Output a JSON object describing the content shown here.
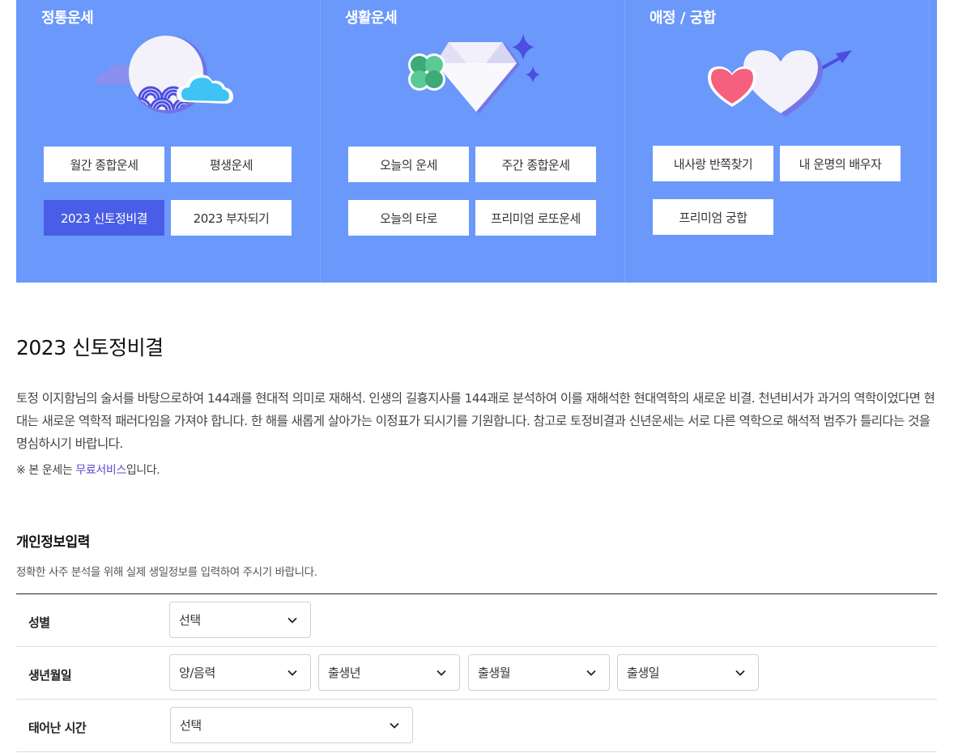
{
  "menu": {
    "columns": [
      {
        "title": "정통운세",
        "buttons": [
          "월간 종합운세",
          "평생운세",
          "2023 신토정비결",
          "2023 부자되기"
        ],
        "active_index": 2
      },
      {
        "title": "생활운세",
        "buttons": [
          "오늘의 운세",
          "주간 종합운세",
          "오늘의 타로",
          "프리미엄 로또운세"
        ],
        "active_index": -1
      },
      {
        "title": "애정 / 궁합",
        "buttons": [
          "내사랑 반쪽찾기",
          "내 운명의 배우자",
          "프리미엄 궁합"
        ],
        "active_index": -1
      }
    ]
  },
  "page": {
    "title": "2023 신토정비결",
    "description": "토정 이지함님의 술서를 바탕으로하여 144괘를 현대적 의미로 재해석. 인생의 길흉지사를 144괘로 분석하여 이를 재해석한 현대역학의 새로운 비결. 천년비서가 과거의 역학이었다면 현대는 새로운 역학적 패러다임을 가져야 합니다. 한 해를 새롭게 살아가는 이정표가 되시기를 기원합니다. 참고로 토정비결과 신년운세는 서로 다른 역학으로 해석적 범주가 틀리다는 것을 명심하시기 바랍니다.",
    "note_prefix": "※ 본 운세는 ",
    "note_highlight": "무료서비스",
    "note_suffix": "입니다."
  },
  "form": {
    "title": "개인정보입력",
    "subtitle": "정확한 사주 분석을 위해 실제 생일정보를 입력하여 주시기 바랍니다.",
    "gender": {
      "label": "성별",
      "value": "선택"
    },
    "birth": {
      "label": "생년월일",
      "calendar": "양/음력",
      "year": "출생년",
      "month": "출생월",
      "day": "출생일"
    },
    "time": {
      "label": "태어난 시간",
      "value": "선택"
    }
  },
  "colors": {
    "menu_bg": "#6b98fb",
    "active_button": "#4a5de6",
    "highlight_text": "#5b4bd6"
  },
  "icons": [
    "moon-waves-cloud-illustration",
    "clover-diamond-sparkle-illustration",
    "hearts-arrow-illustration",
    "chevron-down-icon"
  ]
}
